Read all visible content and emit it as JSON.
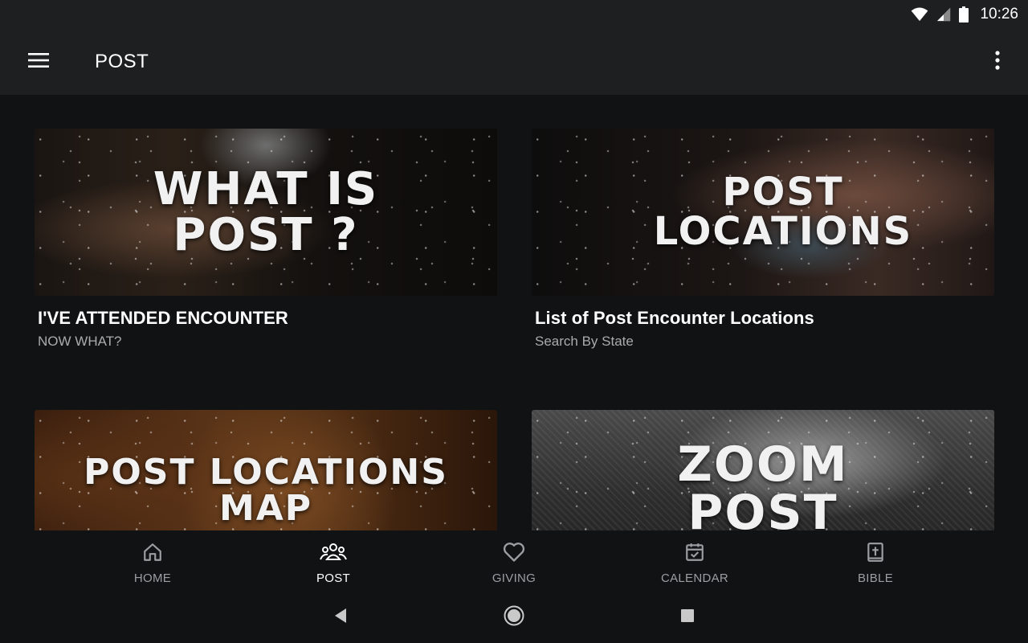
{
  "status_bar": {
    "time": "10:26",
    "icons": [
      "wifi-icon",
      "signal-icon",
      "battery-icon"
    ]
  },
  "app_bar": {
    "title": "POST",
    "menu_icon": "hamburger-menu-icon",
    "more_icon": "more-vert-icon"
  },
  "cards": [
    {
      "banner_text_line1": "WHAT IS",
      "banner_text_line2": "POST ?",
      "title": "I'VE ATTENDED ENCOUNTER",
      "subtitle": "NOW WHAT?"
    },
    {
      "banner_text_line1": "POST",
      "banner_text_line2": "LOCATIONS",
      "title": "List of Post Encounter Locations",
      "subtitle": "Search By State"
    },
    {
      "banner_text_line1": "POST LOCATIONS",
      "banner_text_line2": "MAP",
      "title": "",
      "subtitle": ""
    },
    {
      "banner_text_line1": "ZOOM",
      "banner_text_line2": "POST",
      "title": "",
      "subtitle": ""
    }
  ],
  "bottom_nav": {
    "items": [
      {
        "label": "HOME",
        "icon": "home-icon"
      },
      {
        "label": "POST",
        "icon": "group-icon"
      },
      {
        "label": "GIVING",
        "icon": "heart-icon"
      },
      {
        "label": "CALENDAR",
        "icon": "calendar-check-icon"
      },
      {
        "label": "BIBLE",
        "icon": "bible-icon"
      }
    ],
    "active": "POST"
  },
  "system_nav": {
    "buttons": [
      "back-icon",
      "home-circle-icon",
      "recents-icon"
    ]
  },
  "colors": {
    "background": "#111214",
    "app_bar": "#1e1f21",
    "inactive_nav": "#9c9ea1",
    "subtitle": "#a9abad"
  }
}
